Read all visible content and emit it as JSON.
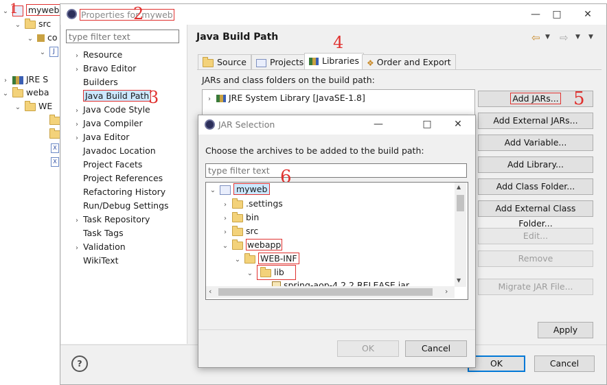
{
  "explorer": {
    "project": "myweb",
    "src": "src",
    "pkg_partial": "co",
    "jre_partial": "JRE S",
    "webapp_partial": "weba",
    "webinf_partial": "WE"
  },
  "props": {
    "title": "Properties for myweb",
    "filter_placeholder": "type filter text",
    "nav": [
      "Resource",
      "Bravo Editor",
      "Builders",
      "Java Build Path",
      "Java Code Style",
      "Java Compiler",
      "Java Editor",
      "Javadoc Location",
      "Project Facets",
      "Project References",
      "Refactoring History",
      "Run/Debug Settings",
      "Task Repository",
      "Task Tags",
      "Validation",
      "WikiText"
    ],
    "page_title": "Java Build Path",
    "tabs": [
      "Source",
      "Projects",
      "Libraries",
      "Order and Export"
    ],
    "jars_label": "JARs and class folders on the build path:",
    "lib_entry": "JRE System Library [JavaSE-1.8]",
    "buttons": [
      "Add JARs...",
      "Add External JARs...",
      "Add Variable...",
      "Add Library...",
      "Add Class Folder...",
      "Add External Class Folder...",
      "Edit...",
      "Remove",
      "Migrate JAR File..."
    ],
    "apply": "Apply",
    "ok": "OK",
    "cancel": "Cancel",
    "help": "?"
  },
  "jar": {
    "title": "JAR Selection",
    "prompt": "Choose the archives to be added to the build path:",
    "filter_placeholder": "type filter text",
    "tree": [
      {
        "label": "myweb",
        "depth": 0,
        "arrow": "down"
      },
      {
        "label": ".settings",
        "depth": 1,
        "arrow": "right"
      },
      {
        "label": "bin",
        "depth": 1,
        "arrow": "right"
      },
      {
        "label": "src",
        "depth": 1,
        "arrow": "right"
      },
      {
        "label": "webapp",
        "depth": 1,
        "arrow": "down"
      },
      {
        "label": "WEB-INF",
        "depth": 2,
        "arrow": "down"
      },
      {
        "label": "lib",
        "depth": 3,
        "arrow": "down"
      },
      {
        "label": "spring-aop-4.2.2.RELEASE.jar",
        "depth": 4,
        "arrow": ""
      }
    ],
    "ok": "OK",
    "cancel": "Cancel"
  },
  "annotations": [
    "1",
    "2",
    "3",
    "4",
    "5",
    "6"
  ],
  "colors": {
    "annotation": "#e0302e",
    "selection": "#cce8ff",
    "accent": "#0078d7"
  }
}
